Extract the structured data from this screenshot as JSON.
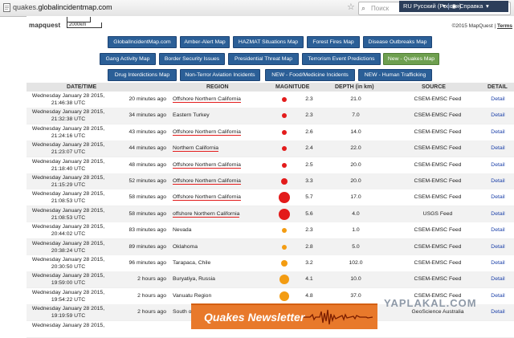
{
  "browser": {
    "url_prefix": "quakes.",
    "url_domain": "globalincidentmap.com",
    "search_placeholder": "Поиск",
    "lang_label": "RU Русский (Россия)",
    "help_label": "Справка",
    "menu_arrow": "▾"
  },
  "map": {
    "logo": "mapquest",
    "scale_label": "2000km",
    "copyright": "©2015 MapQuest |",
    "terms": "Terms"
  },
  "nav": {
    "row1": [
      "GlobalIncidentMap.com",
      "Amber-Alert Map",
      "HAZMAT Situations Map",
      "Forest Fires Map",
      "Disease Outbreaks Map"
    ],
    "row2": [
      "Gang Activity Map",
      "Border Security Issues",
      "Presidential Threat Map",
      "Terrorism Event Predictions",
      "New - Quakes Map"
    ],
    "row3": [
      "Drug Interdictions Map",
      "Non-Terror Aviation Incidents",
      "NEW - Food/Medicine Incidents",
      "NEW - Human Trafficking"
    ],
    "active": "New - Quakes Map"
  },
  "table": {
    "headers": {
      "datetime": "DATE/TIME",
      "region": "REGION",
      "magnitude": "MAGNITUDE",
      "depth": "DEPTH (in km)",
      "source": "SOURCE",
      "detail": "DETAIL"
    },
    "rows": [
      {
        "date": "Wednesday January 28 2015,",
        "time": "21:46:38 UTC",
        "age": "20 minutes ago",
        "region": "Offshore Northern California",
        "underlined": true,
        "magnitude": "2.3",
        "depth": "21.0",
        "source": "CSEM-EMSC Feed",
        "detail": "Detail"
      },
      {
        "date": "Wednesday January 28 2015,",
        "time": "21:32:38 UTC",
        "age": "34 minutes ago",
        "region": "Eastern Turkey",
        "underlined": false,
        "magnitude": "2.3",
        "depth": "7.0",
        "source": "CSEM-EMSC Feed",
        "detail": "Detail"
      },
      {
        "date": "Wednesday January 28 2015,",
        "time": "21:24:16 UTC",
        "age": "43 minutes ago",
        "region": "Offshore Northern California",
        "underlined": true,
        "magnitude": "2.6",
        "depth": "14.0",
        "source": "CSEM-EMSC Feed",
        "detail": "Detail"
      },
      {
        "date": "Wednesday January 28 2015,",
        "time": "21:23:07 UTC",
        "age": "44 minutes ago",
        "region": "Northern California",
        "underlined": true,
        "magnitude": "2.4",
        "depth": "22.0",
        "source": "CSEM-EMSC Feed",
        "detail": "Detail"
      },
      {
        "date": "Wednesday January 28 2015,",
        "time": "21:18:40 UTC",
        "age": "48 minutes ago",
        "region": "Offshore Northern California",
        "underlined": true,
        "magnitude": "2.5",
        "depth": "20.0",
        "source": "CSEM-EMSC Feed",
        "detail": "Detail"
      },
      {
        "date": "Wednesday January 28 2015,",
        "time": "21:15:29 UTC",
        "age": "52 minutes ago",
        "region": "Offshore Northern California",
        "underlined": true,
        "magnitude": "3.3",
        "depth": "20.0",
        "source": "CSEM-EMSC Feed",
        "detail": "Detail"
      },
      {
        "date": "Wednesday January 28 2015,",
        "time": "21:08:53 UTC",
        "age": "58 minutes ago",
        "region": "Offshore Northern California",
        "underlined": true,
        "magnitude": "5.7",
        "depth": "17.0",
        "source": "CSEM-EMSC Feed",
        "detail": "Detail"
      },
      {
        "date": "Wednesday January 28 2015,",
        "time": "21:08:53 UTC",
        "age": "58 minutes ago",
        "region": "offshore Northern California",
        "underlined": true,
        "magnitude": "5.6",
        "depth": "4.0",
        "source": "USGS Feed",
        "detail": "Detail"
      },
      {
        "date": "Wednesday January 28 2015,",
        "time": "20:44:02 UTC",
        "age": "83 minutes ago",
        "region": "Nevada",
        "underlined": false,
        "magnitude": "2.3",
        "depth": "1.0",
        "source": "CSEM-EMSC Feed",
        "detail": "Detail"
      },
      {
        "date": "Wednesday January 28 2015,",
        "time": "20:38:24 UTC",
        "age": "89 minutes ago",
        "region": "Oklahoma",
        "underlined": false,
        "magnitude": "2.8",
        "depth": "5.0",
        "source": "CSEM-EMSC Feed",
        "detail": "Detail"
      },
      {
        "date": "Wednesday January 28 2015,",
        "time": "20:30:50 UTC",
        "age": "96 minutes ago",
        "region": "Tarapaca, Chile",
        "underlined": false,
        "magnitude": "3.2",
        "depth": "102.0",
        "source": "CSEM-EMSC Feed",
        "detail": "Detail"
      },
      {
        "date": "Wednesday January 28 2015,",
        "time": "19:59:00 UTC",
        "age": "2 hours ago",
        "region": "Buryatiya, Russia",
        "underlined": false,
        "magnitude": "4.1",
        "depth": "10.0",
        "source": "CSEM-EMSC Feed",
        "detail": "Detail"
      },
      {
        "date": "Wednesday January 28 2015,",
        "time": "19:54:22 UTC",
        "age": "2 hours ago",
        "region": "Vanuatu Region",
        "underlined": false,
        "magnitude": "4.8",
        "depth": "37.0",
        "source": "CSEM-EMSC Feed",
        "detail": "Detail"
      },
      {
        "date": "Wednesday January 28 2015,",
        "time": "19:19:59 UTC",
        "age": "2 hours ago",
        "region": "South of",
        "underlined": false,
        "magnitude": "",
        "depth": "",
        "source": "GeoScience Australia",
        "detail": "Detail"
      },
      {
        "date": "Wednesday January 28 2015,",
        "time": "",
        "age": "",
        "region": "",
        "underlined": false,
        "magnitude": "",
        "depth": "",
        "source": "",
        "detail": ""
      }
    ]
  },
  "colors": {
    "nav_blue": "#2b5f97",
    "nav_active": "#6e9f4f",
    "dot_red": "#e31b1b",
    "dot_orange": "#f39c12",
    "underline_red": "#e31b1b",
    "detail_link": "#1a3fa8"
  },
  "overlay": {
    "newsletter": "Quakes Newsletter",
    "watermark": "YAPLAKAL.COM"
  }
}
